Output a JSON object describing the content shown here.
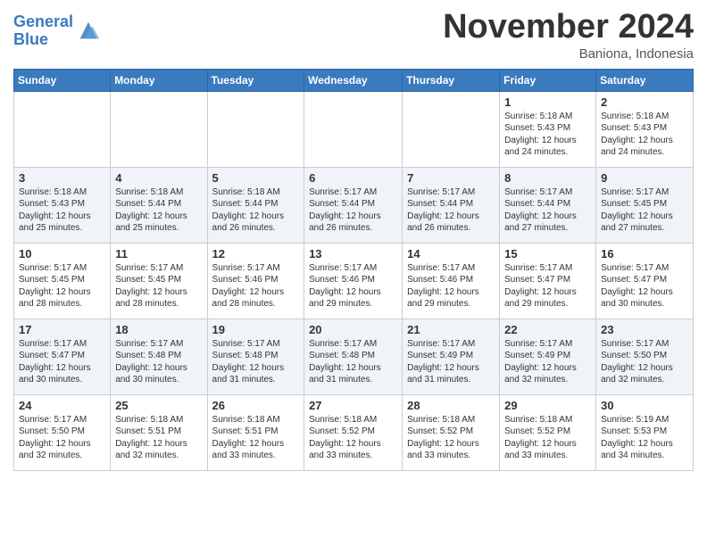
{
  "header": {
    "logo_line1": "General",
    "logo_line2": "Blue",
    "month": "November 2024",
    "location": "Baniona, Indonesia"
  },
  "days_of_week": [
    "Sunday",
    "Monday",
    "Tuesday",
    "Wednesday",
    "Thursday",
    "Friday",
    "Saturday"
  ],
  "weeks": [
    [
      {
        "day": "",
        "info": ""
      },
      {
        "day": "",
        "info": ""
      },
      {
        "day": "",
        "info": ""
      },
      {
        "day": "",
        "info": ""
      },
      {
        "day": "",
        "info": ""
      },
      {
        "day": "1",
        "info": "Sunrise: 5:18 AM\nSunset: 5:43 PM\nDaylight: 12 hours and 24 minutes."
      },
      {
        "day": "2",
        "info": "Sunrise: 5:18 AM\nSunset: 5:43 PM\nDaylight: 12 hours and 24 minutes."
      }
    ],
    [
      {
        "day": "3",
        "info": "Sunrise: 5:18 AM\nSunset: 5:43 PM\nDaylight: 12 hours and 25 minutes."
      },
      {
        "day": "4",
        "info": "Sunrise: 5:18 AM\nSunset: 5:44 PM\nDaylight: 12 hours and 25 minutes."
      },
      {
        "day": "5",
        "info": "Sunrise: 5:18 AM\nSunset: 5:44 PM\nDaylight: 12 hours and 26 minutes."
      },
      {
        "day": "6",
        "info": "Sunrise: 5:17 AM\nSunset: 5:44 PM\nDaylight: 12 hours and 26 minutes."
      },
      {
        "day": "7",
        "info": "Sunrise: 5:17 AM\nSunset: 5:44 PM\nDaylight: 12 hours and 26 minutes."
      },
      {
        "day": "8",
        "info": "Sunrise: 5:17 AM\nSunset: 5:44 PM\nDaylight: 12 hours and 27 minutes."
      },
      {
        "day": "9",
        "info": "Sunrise: 5:17 AM\nSunset: 5:45 PM\nDaylight: 12 hours and 27 minutes."
      }
    ],
    [
      {
        "day": "10",
        "info": "Sunrise: 5:17 AM\nSunset: 5:45 PM\nDaylight: 12 hours and 28 minutes."
      },
      {
        "day": "11",
        "info": "Sunrise: 5:17 AM\nSunset: 5:45 PM\nDaylight: 12 hours and 28 minutes."
      },
      {
        "day": "12",
        "info": "Sunrise: 5:17 AM\nSunset: 5:46 PM\nDaylight: 12 hours and 28 minutes."
      },
      {
        "day": "13",
        "info": "Sunrise: 5:17 AM\nSunset: 5:46 PM\nDaylight: 12 hours and 29 minutes."
      },
      {
        "day": "14",
        "info": "Sunrise: 5:17 AM\nSunset: 5:46 PM\nDaylight: 12 hours and 29 minutes."
      },
      {
        "day": "15",
        "info": "Sunrise: 5:17 AM\nSunset: 5:47 PM\nDaylight: 12 hours and 29 minutes."
      },
      {
        "day": "16",
        "info": "Sunrise: 5:17 AM\nSunset: 5:47 PM\nDaylight: 12 hours and 30 minutes."
      }
    ],
    [
      {
        "day": "17",
        "info": "Sunrise: 5:17 AM\nSunset: 5:47 PM\nDaylight: 12 hours and 30 minutes."
      },
      {
        "day": "18",
        "info": "Sunrise: 5:17 AM\nSunset: 5:48 PM\nDaylight: 12 hours and 30 minutes."
      },
      {
        "day": "19",
        "info": "Sunrise: 5:17 AM\nSunset: 5:48 PM\nDaylight: 12 hours and 31 minutes."
      },
      {
        "day": "20",
        "info": "Sunrise: 5:17 AM\nSunset: 5:48 PM\nDaylight: 12 hours and 31 minutes."
      },
      {
        "day": "21",
        "info": "Sunrise: 5:17 AM\nSunset: 5:49 PM\nDaylight: 12 hours and 31 minutes."
      },
      {
        "day": "22",
        "info": "Sunrise: 5:17 AM\nSunset: 5:49 PM\nDaylight: 12 hours and 32 minutes."
      },
      {
        "day": "23",
        "info": "Sunrise: 5:17 AM\nSunset: 5:50 PM\nDaylight: 12 hours and 32 minutes."
      }
    ],
    [
      {
        "day": "24",
        "info": "Sunrise: 5:17 AM\nSunset: 5:50 PM\nDaylight: 12 hours and 32 minutes."
      },
      {
        "day": "25",
        "info": "Sunrise: 5:18 AM\nSunset: 5:51 PM\nDaylight: 12 hours and 32 minutes."
      },
      {
        "day": "26",
        "info": "Sunrise: 5:18 AM\nSunset: 5:51 PM\nDaylight: 12 hours and 33 minutes."
      },
      {
        "day": "27",
        "info": "Sunrise: 5:18 AM\nSunset: 5:52 PM\nDaylight: 12 hours and 33 minutes."
      },
      {
        "day": "28",
        "info": "Sunrise: 5:18 AM\nSunset: 5:52 PM\nDaylight: 12 hours and 33 minutes."
      },
      {
        "day": "29",
        "info": "Sunrise: 5:18 AM\nSunset: 5:52 PM\nDaylight: 12 hours and 33 minutes."
      },
      {
        "day": "30",
        "info": "Sunrise: 5:19 AM\nSunset: 5:53 PM\nDaylight: 12 hours and 34 minutes."
      }
    ]
  ]
}
